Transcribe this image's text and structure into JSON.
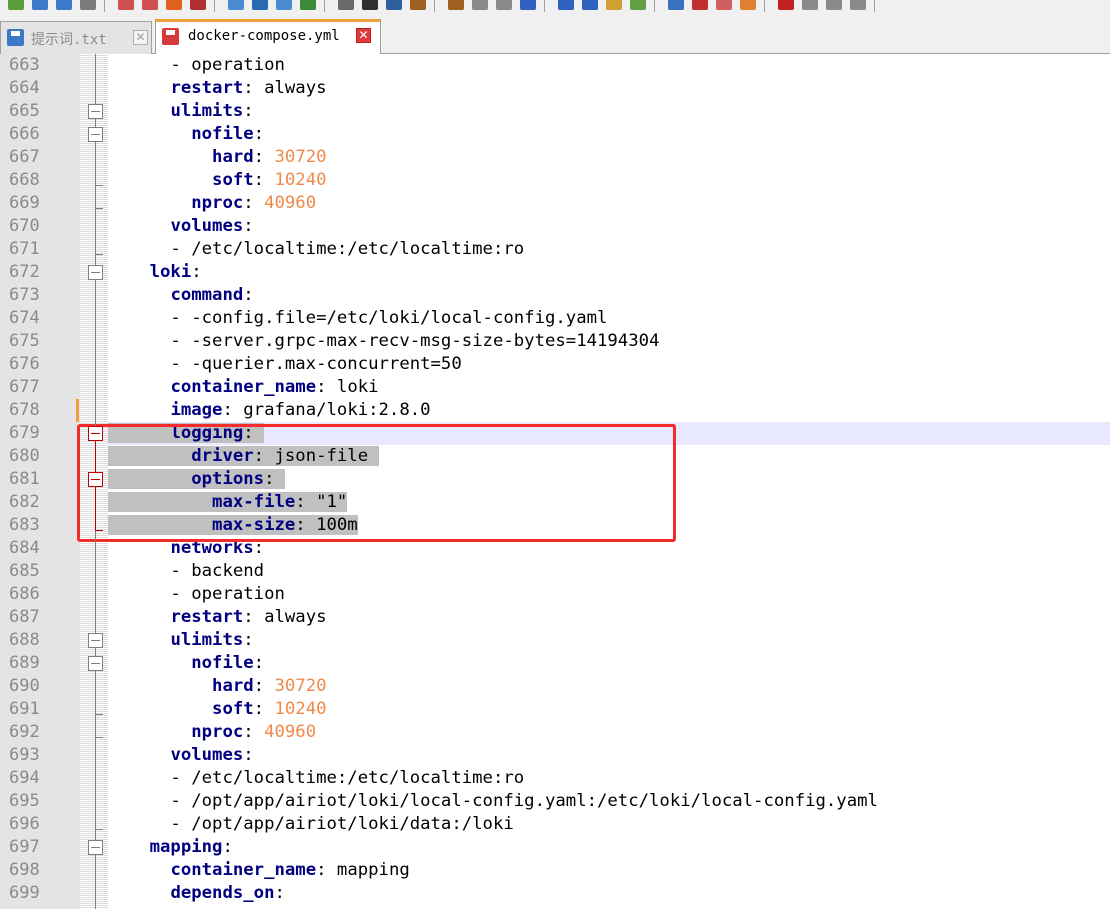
{
  "tabs": [
    {
      "label": "提示词.txt",
      "state": "inactive",
      "icon": "save-disk-icon"
    },
    {
      "label": "docker-compose.yml",
      "state": "active",
      "icon": "unsaved-disk-icon"
    }
  ],
  "editor": {
    "caret_line": 679,
    "lines": [
      {
        "n": "663",
        "parts": [
          [
            "t",
            "      - operation"
          ]
        ]
      },
      {
        "n": "664",
        "parts": [
          [
            "t",
            "      "
          ],
          [
            "k",
            "restart"
          ],
          [
            "t",
            ": always"
          ]
        ]
      },
      {
        "n": "665",
        "parts": [
          [
            "t",
            "      "
          ],
          [
            "k",
            "ulimits"
          ],
          [
            "t",
            ":"
          ]
        ]
      },
      {
        "n": "666",
        "parts": [
          [
            "t",
            "        "
          ],
          [
            "k",
            "nofile"
          ],
          [
            "t",
            ":"
          ]
        ]
      },
      {
        "n": "667",
        "parts": [
          [
            "t",
            "          "
          ],
          [
            "k",
            "hard"
          ],
          [
            "t",
            ": "
          ],
          [
            "n",
            "30720"
          ]
        ]
      },
      {
        "n": "668",
        "parts": [
          [
            "t",
            "          "
          ],
          [
            "k",
            "soft"
          ],
          [
            "t",
            ": "
          ],
          [
            "n",
            "10240"
          ]
        ]
      },
      {
        "n": "669",
        "parts": [
          [
            "t",
            "        "
          ],
          [
            "k",
            "nproc"
          ],
          [
            "t",
            ": "
          ],
          [
            "n",
            "40960"
          ]
        ]
      },
      {
        "n": "670",
        "parts": [
          [
            "t",
            "      "
          ],
          [
            "k",
            "volumes"
          ],
          [
            "t",
            ":"
          ]
        ]
      },
      {
        "n": "671",
        "parts": [
          [
            "t",
            "      - /etc/localtime:/etc/localtime:ro"
          ]
        ]
      },
      {
        "n": "672",
        "parts": [
          [
            "t",
            "    "
          ],
          [
            "k",
            "loki"
          ],
          [
            "t",
            ":"
          ]
        ]
      },
      {
        "n": "673",
        "parts": [
          [
            "t",
            "      "
          ],
          [
            "k",
            "command"
          ],
          [
            "t",
            ":"
          ]
        ]
      },
      {
        "n": "674",
        "parts": [
          [
            "t",
            "      - -config.file=/etc/loki/local-config.yaml"
          ]
        ]
      },
      {
        "n": "675",
        "parts": [
          [
            "t",
            "      - -server.grpc-max-recv-msg-size-bytes=14194304"
          ]
        ]
      },
      {
        "n": "676",
        "parts": [
          [
            "t",
            "      - -querier.max-concurrent=50"
          ]
        ]
      },
      {
        "n": "677",
        "parts": [
          [
            "t",
            "      "
          ],
          [
            "k",
            "container_name"
          ],
          [
            "t",
            ": loki"
          ]
        ]
      },
      {
        "n": "678",
        "parts": [
          [
            "t",
            "      "
          ],
          [
            "k",
            "image"
          ],
          [
            "t",
            ": grafana/loki:2.8.0"
          ]
        ]
      },
      {
        "n": "679",
        "sel": true,
        "parts": [
          [
            "t",
            "      "
          ],
          [
            "k",
            "logging"
          ],
          [
            "t",
            ": "
          ]
        ]
      },
      {
        "n": "680",
        "sel": true,
        "parts": [
          [
            "t",
            "        "
          ],
          [
            "k",
            "driver"
          ],
          [
            "t",
            ": json-file "
          ]
        ]
      },
      {
        "n": "681",
        "sel": true,
        "parts": [
          [
            "t",
            "        "
          ],
          [
            "k",
            "options"
          ],
          [
            "t",
            ": "
          ]
        ]
      },
      {
        "n": "682",
        "sel": true,
        "parts": [
          [
            "t",
            "          "
          ],
          [
            "k",
            "max-file"
          ],
          [
            "t",
            ": \"1\""
          ]
        ]
      },
      {
        "n": "683",
        "sel": true,
        "parts": [
          [
            "t",
            "          "
          ],
          [
            "k",
            "max-size"
          ],
          [
            "t",
            ": 100m"
          ]
        ]
      },
      {
        "n": "684",
        "parts": [
          [
            "t",
            "      "
          ],
          [
            "k",
            "networks"
          ],
          [
            "t",
            ":"
          ]
        ]
      },
      {
        "n": "685",
        "parts": [
          [
            "t",
            "      - backend"
          ]
        ]
      },
      {
        "n": "686",
        "parts": [
          [
            "t",
            "      - operation"
          ]
        ]
      },
      {
        "n": "687",
        "parts": [
          [
            "t",
            "      "
          ],
          [
            "k",
            "restart"
          ],
          [
            "t",
            ": always"
          ]
        ]
      },
      {
        "n": "688",
        "parts": [
          [
            "t",
            "      "
          ],
          [
            "k",
            "ulimits"
          ],
          [
            "t",
            ":"
          ]
        ]
      },
      {
        "n": "689",
        "parts": [
          [
            "t",
            "        "
          ],
          [
            "k",
            "nofile"
          ],
          [
            "t",
            ":"
          ]
        ]
      },
      {
        "n": "690",
        "parts": [
          [
            "t",
            "          "
          ],
          [
            "k",
            "hard"
          ],
          [
            "t",
            ": "
          ],
          [
            "n",
            "30720"
          ]
        ]
      },
      {
        "n": "691",
        "parts": [
          [
            "t",
            "          "
          ],
          [
            "k",
            "soft"
          ],
          [
            "t",
            ": "
          ],
          [
            "n",
            "10240"
          ]
        ]
      },
      {
        "n": "692",
        "parts": [
          [
            "t",
            "        "
          ],
          [
            "k",
            "nproc"
          ],
          [
            "t",
            ": "
          ],
          [
            "n",
            "40960"
          ]
        ]
      },
      {
        "n": "693",
        "parts": [
          [
            "t",
            "      "
          ],
          [
            "k",
            "volumes"
          ],
          [
            "t",
            ":"
          ]
        ]
      },
      {
        "n": "694",
        "parts": [
          [
            "t",
            "      - /etc/localtime:/etc/localtime:ro"
          ]
        ]
      },
      {
        "n": "695",
        "parts": [
          [
            "t",
            "      - /opt/app/airiot/loki/local-config.yaml:/etc/loki/local-config.yaml"
          ]
        ]
      },
      {
        "n": "696",
        "parts": [
          [
            "t",
            "      - /opt/app/airiot/loki/data:/loki"
          ]
        ]
      },
      {
        "n": "697",
        "parts": [
          [
            "t",
            "    "
          ],
          [
            "k",
            "mapping"
          ],
          [
            "t",
            ":"
          ]
        ]
      },
      {
        "n": "698",
        "parts": [
          [
            "t",
            "      "
          ],
          [
            "k",
            "container_name"
          ],
          [
            "t",
            ": mapping"
          ]
        ]
      },
      {
        "n": "699",
        "parts": [
          [
            "t",
            "      "
          ],
          [
            "k",
            "depends_on"
          ],
          [
            "t",
            ":"
          ]
        ]
      }
    ]
  },
  "colors": {
    "keyword": "#000080",
    "number": "#f0894a",
    "selection": "#c0c0c0",
    "highlight_box": "#f22b2b",
    "tab_accent": "#f2a03d"
  }
}
